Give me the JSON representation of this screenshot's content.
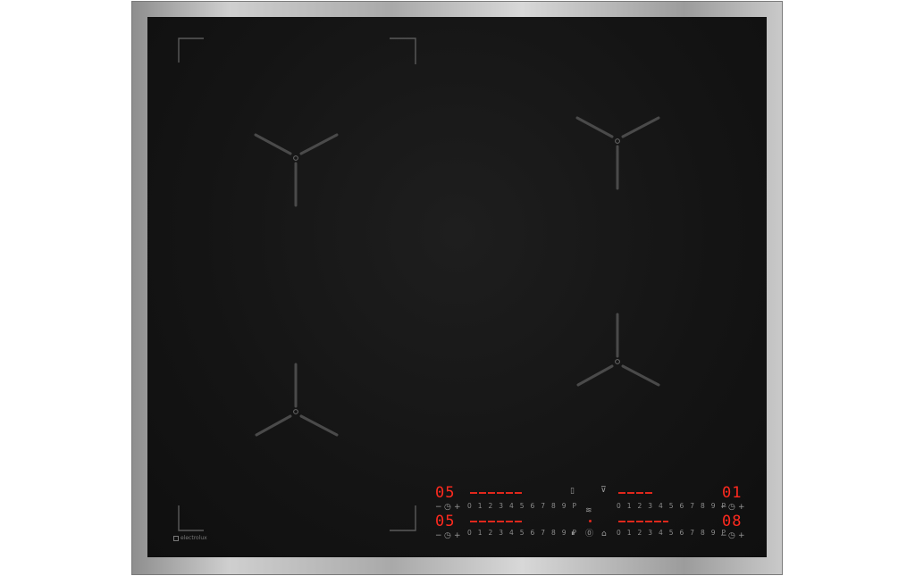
{
  "cooktop": {
    "brand": "electrolux",
    "displays": {
      "zone_top_left": "05",
      "zone_bottom_left": "05",
      "zone_top_right": "01",
      "zone_bottom_right": "08"
    },
    "power_scale_full": "0 1 2 3 4 5 6 7 8 9 P",
    "minus": "−",
    "plus": "+",
    "timer_icon": "clock-icon",
    "center_icons": [
      "bridge-icon",
      "hob2hood-icon",
      "keep-warm-icon",
      "pause-icon",
      "power-icon",
      "lock-icon"
    ],
    "colors": {
      "display_red": "#ff2a1f",
      "glass": "#141414",
      "frame": "#b8b8b8"
    }
  }
}
